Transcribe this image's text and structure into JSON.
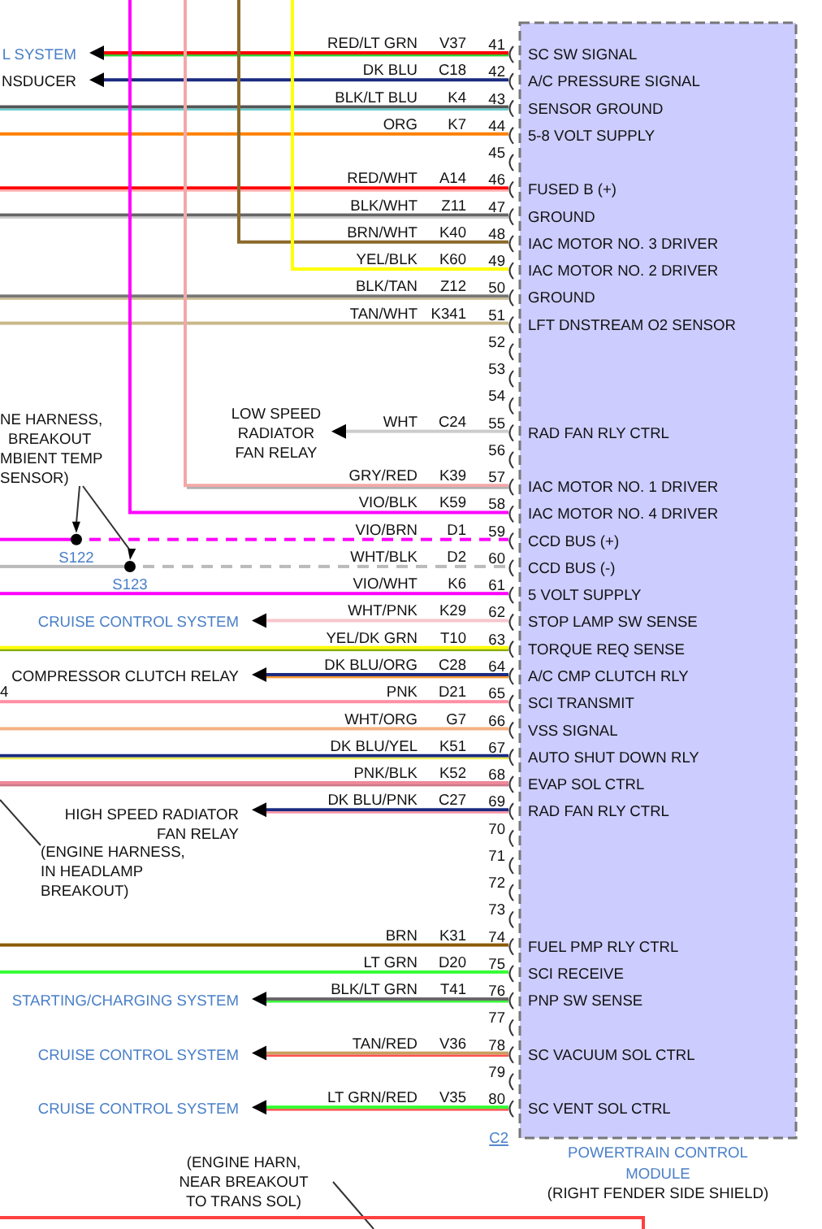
{
  "pins": [
    {
      "number": "41",
      "kind": "arrow",
      "wire": "RED/LT GRN",
      "circuit": "V37",
      "function": "SC SW SIGNAL",
      "color": "#ff0000",
      "stripe": {
        "color": "#33cc33"
      },
      "destination": [
        "L SYSTEM"
      ],
      "linked": true
    },
    {
      "number": "42",
      "kind": "arrow",
      "wire": "DK BLU",
      "circuit": "C18",
      "function": "A/C PRESSURE SIGNAL",
      "color": "#1a2a80",
      "destination": [
        "NSDUCER"
      ],
      "linked": false
    },
    {
      "number": "43",
      "kind": "edge",
      "wire": "BLK/LT BLU",
      "circuit": "K4",
      "function": "SENSOR GROUND",
      "color": "#555555",
      "stripe": {
        "color": "#66cccc"
      }
    },
    {
      "number": "44",
      "kind": "edge",
      "wire": "ORG",
      "circuit": "K7",
      "function": "5-8 VOLT SUPPLY",
      "color": "#ff8000"
    },
    {
      "number": "45",
      "kind": "empty"
    },
    {
      "number": "46",
      "kind": "edge",
      "wire": "RED/WHT",
      "circuit": "A14",
      "function": "FUSED B (+)",
      "color": "#ff0000",
      "stripe": {
        "color": "#ffaaaa"
      }
    },
    {
      "number": "47",
      "kind": "edge",
      "wire": "BLK/WHT",
      "circuit": "Z11",
      "function": "GROUND",
      "color": "#666666",
      "stripe": {
        "color": "#cccccc"
      }
    },
    {
      "number": "48",
      "kind": "riser",
      "wire": "BRN/WHT",
      "circuit": "K40",
      "function": "IAC MOTOR NO. 3 DRIVER",
      "color": "#8b6a2b"
    },
    {
      "number": "49",
      "kind": "riser",
      "wire": "YEL/BLK",
      "circuit": "K60",
      "function": "IAC MOTOR NO. 2 DRIVER",
      "color": "#ffff00"
    },
    {
      "number": "50",
      "kind": "edge",
      "wire": "BLK/TAN",
      "circuit": "Z12",
      "function": "GROUND",
      "color": "#777777",
      "stripe": {
        "color": "#c8b88a"
      }
    },
    {
      "number": "51",
      "kind": "edge",
      "wire": "TAN/WHT",
      "circuit": "K341",
      "function": "LFT DNSTREAM O2 SENSOR",
      "color": "#c8b88a"
    },
    {
      "number": "52",
      "kind": "empty"
    },
    {
      "number": "53",
      "kind": "empty"
    },
    {
      "number": "54",
      "kind": "empty"
    },
    {
      "number": "55",
      "kind": "arrow",
      "wire": "WHT",
      "circuit": "C24",
      "function": "RAD FAN RLY CTRL",
      "color": "#cccccc",
      "destination": [
        "LOW SPEED",
        "RADIATOR",
        "FAN RELAY"
      ],
      "linked": false
    },
    {
      "number": "56",
      "kind": "empty"
    },
    {
      "number": "57",
      "kind": "riser",
      "wire": "GRY/RED",
      "circuit": "K39",
      "function": "IAC MOTOR NO. 1 DRIVER",
      "color": "#f2a8a8",
      "stripe": {
        "color": "#aaaaaa"
      }
    },
    {
      "number": "58",
      "kind": "riser",
      "wire": "VIO/BLK",
      "circuit": "K59",
      "function": "IAC MOTOR NO. 4 DRIVER",
      "color": "#ff00ff"
    },
    {
      "number": "59",
      "kind": "splice",
      "wire": "VIO/BRN",
      "circuit": "D1",
      "function": "CCD BUS (+)",
      "color": "#ff00ff",
      "splice": "S122"
    },
    {
      "number": "60",
      "kind": "splice",
      "wire": "WHT/BLK",
      "circuit": "D2",
      "function": "CCD BUS (-)",
      "color": "#bbbbbb",
      "splice": "S123"
    },
    {
      "number": "61",
      "kind": "edge",
      "wire": "VIO/WHT",
      "circuit": "K6",
      "function": "5 VOLT SUPPLY",
      "color": "#ff00ff"
    },
    {
      "number": "62",
      "kind": "arrow",
      "wire": "WHT/PNK",
      "circuit": "K29",
      "function": "STOP LAMP SW SENSE",
      "color": "#f6c6cc",
      "destination": [
        "CRUISE CONTROL SYSTEM"
      ],
      "linked": true
    },
    {
      "number": "63",
      "kind": "edge",
      "wire": "YEL/DK GRN",
      "circuit": "T10",
      "function": "TORQUE REQ SENSE",
      "color": "#ffff00",
      "stripe": {
        "color": "#88aa00"
      }
    },
    {
      "number": "64",
      "kind": "arrow",
      "wire": "DK BLU/ORG",
      "circuit": "C28",
      "function": "A/C CMP CLUTCH RLY",
      "color": "#1a2a80",
      "stripe": {
        "color": "#ff9933"
      },
      "destination": [
        "COMPRESSOR CLUTCH RELAY"
      ],
      "linked": false
    },
    {
      "number": "65",
      "kind": "edge",
      "wire": "PNK",
      "circuit": "D21",
      "function": "SCI TRANSMIT",
      "color": "#ff8fa3",
      "edge_label": "4"
    },
    {
      "number": "66",
      "kind": "edge",
      "wire": "WHT/ORG",
      "circuit": "G7",
      "function": "VSS SIGNAL",
      "color": "#f4b183"
    },
    {
      "number": "67",
      "kind": "edge",
      "wire": "DK BLU/YEL",
      "circuit": "K51",
      "function": "AUTO SHUT DOWN RLY",
      "color": "#1a2a80",
      "stripe": {
        "color": "#eeee55"
      }
    },
    {
      "number": "68",
      "kind": "edge",
      "wire": "PNK/BLK",
      "circuit": "K52",
      "function": "EVAP SOL CTRL",
      "color": "#ee8899",
      "stripe": {
        "color": "#cc7788"
      }
    },
    {
      "number": "69",
      "kind": "arrow",
      "wire": "DK BLU/PNK",
      "circuit": "C27",
      "function": "RAD FAN RLY CTRL",
      "color": "#1a2a80",
      "stripe": {
        "color": "#ff8fa3"
      },
      "destination": [
        "HIGH SPEED RADIATOR",
        "FAN RELAY"
      ],
      "linked": false
    },
    {
      "number": "70",
      "kind": "empty"
    },
    {
      "number": "71",
      "kind": "empty"
    },
    {
      "number": "72",
      "kind": "empty"
    },
    {
      "number": "73",
      "kind": "empty"
    },
    {
      "number": "74",
      "kind": "edge",
      "wire": "BRN",
      "circuit": "K31",
      "function": "FUEL PMP RLY CTRL",
      "color": "#8b5a00"
    },
    {
      "number": "75",
      "kind": "edge",
      "wire": "LT GRN",
      "circuit": "D20",
      "function": "SCI RECEIVE",
      "color": "#33ff33"
    },
    {
      "number": "76",
      "kind": "arrow",
      "wire": "BLK/LT GRN",
      "circuit": "T41",
      "function": "PNP SW SENSE",
      "color": "#666666",
      "stripe": {
        "color": "#33ff33"
      },
      "destination": [
        "STARTING/CHARGING SYSTEM"
      ],
      "linked": true
    },
    {
      "number": "77",
      "kind": "empty"
    },
    {
      "number": "78",
      "kind": "arrow",
      "wire": "TAN/RED",
      "circuit": "V36",
      "function": "SC VACUUM SOL CTRL",
      "color": "#c8a060",
      "stripe": {
        "color": "#ff5050"
      },
      "destination": [
        "CRUISE CONTROL SYSTEM"
      ],
      "linked": true
    },
    {
      "number": "79",
      "kind": "empty"
    },
    {
      "number": "80",
      "kind": "arrow",
      "wire": "LT GRN/RED",
      "circuit": "V35",
      "function": "SC VENT SOL CTRL",
      "color": "#33ff33",
      "stripe": {
        "color": "#ff5050"
      },
      "destination": [
        "CRUISE CONTROL SYSTEM"
      ],
      "linked": true
    }
  ],
  "notes": [
    {
      "lines": [
        "NE HARNESS,",
        "BREAKOUT",
        "MBIENT TEMP",
        "SENSOR)"
      ]
    },
    {
      "lines": [
        "(ENGINE HARNESS,",
        "IN HEADLAMP",
        "BREAKOUT)"
      ]
    },
    {
      "lines": [
        "(ENGINE HARN,",
        "NEAR BREAKOUT",
        "TO TRANS SOL)"
      ]
    }
  ],
  "connector": {
    "label": "C2"
  },
  "module": {
    "name_lines": [
      "POWERTRAIN CONTROL",
      "MODULE"
    ],
    "location": "(RIGHT FENDER SIDE SHIELD)"
  }
}
